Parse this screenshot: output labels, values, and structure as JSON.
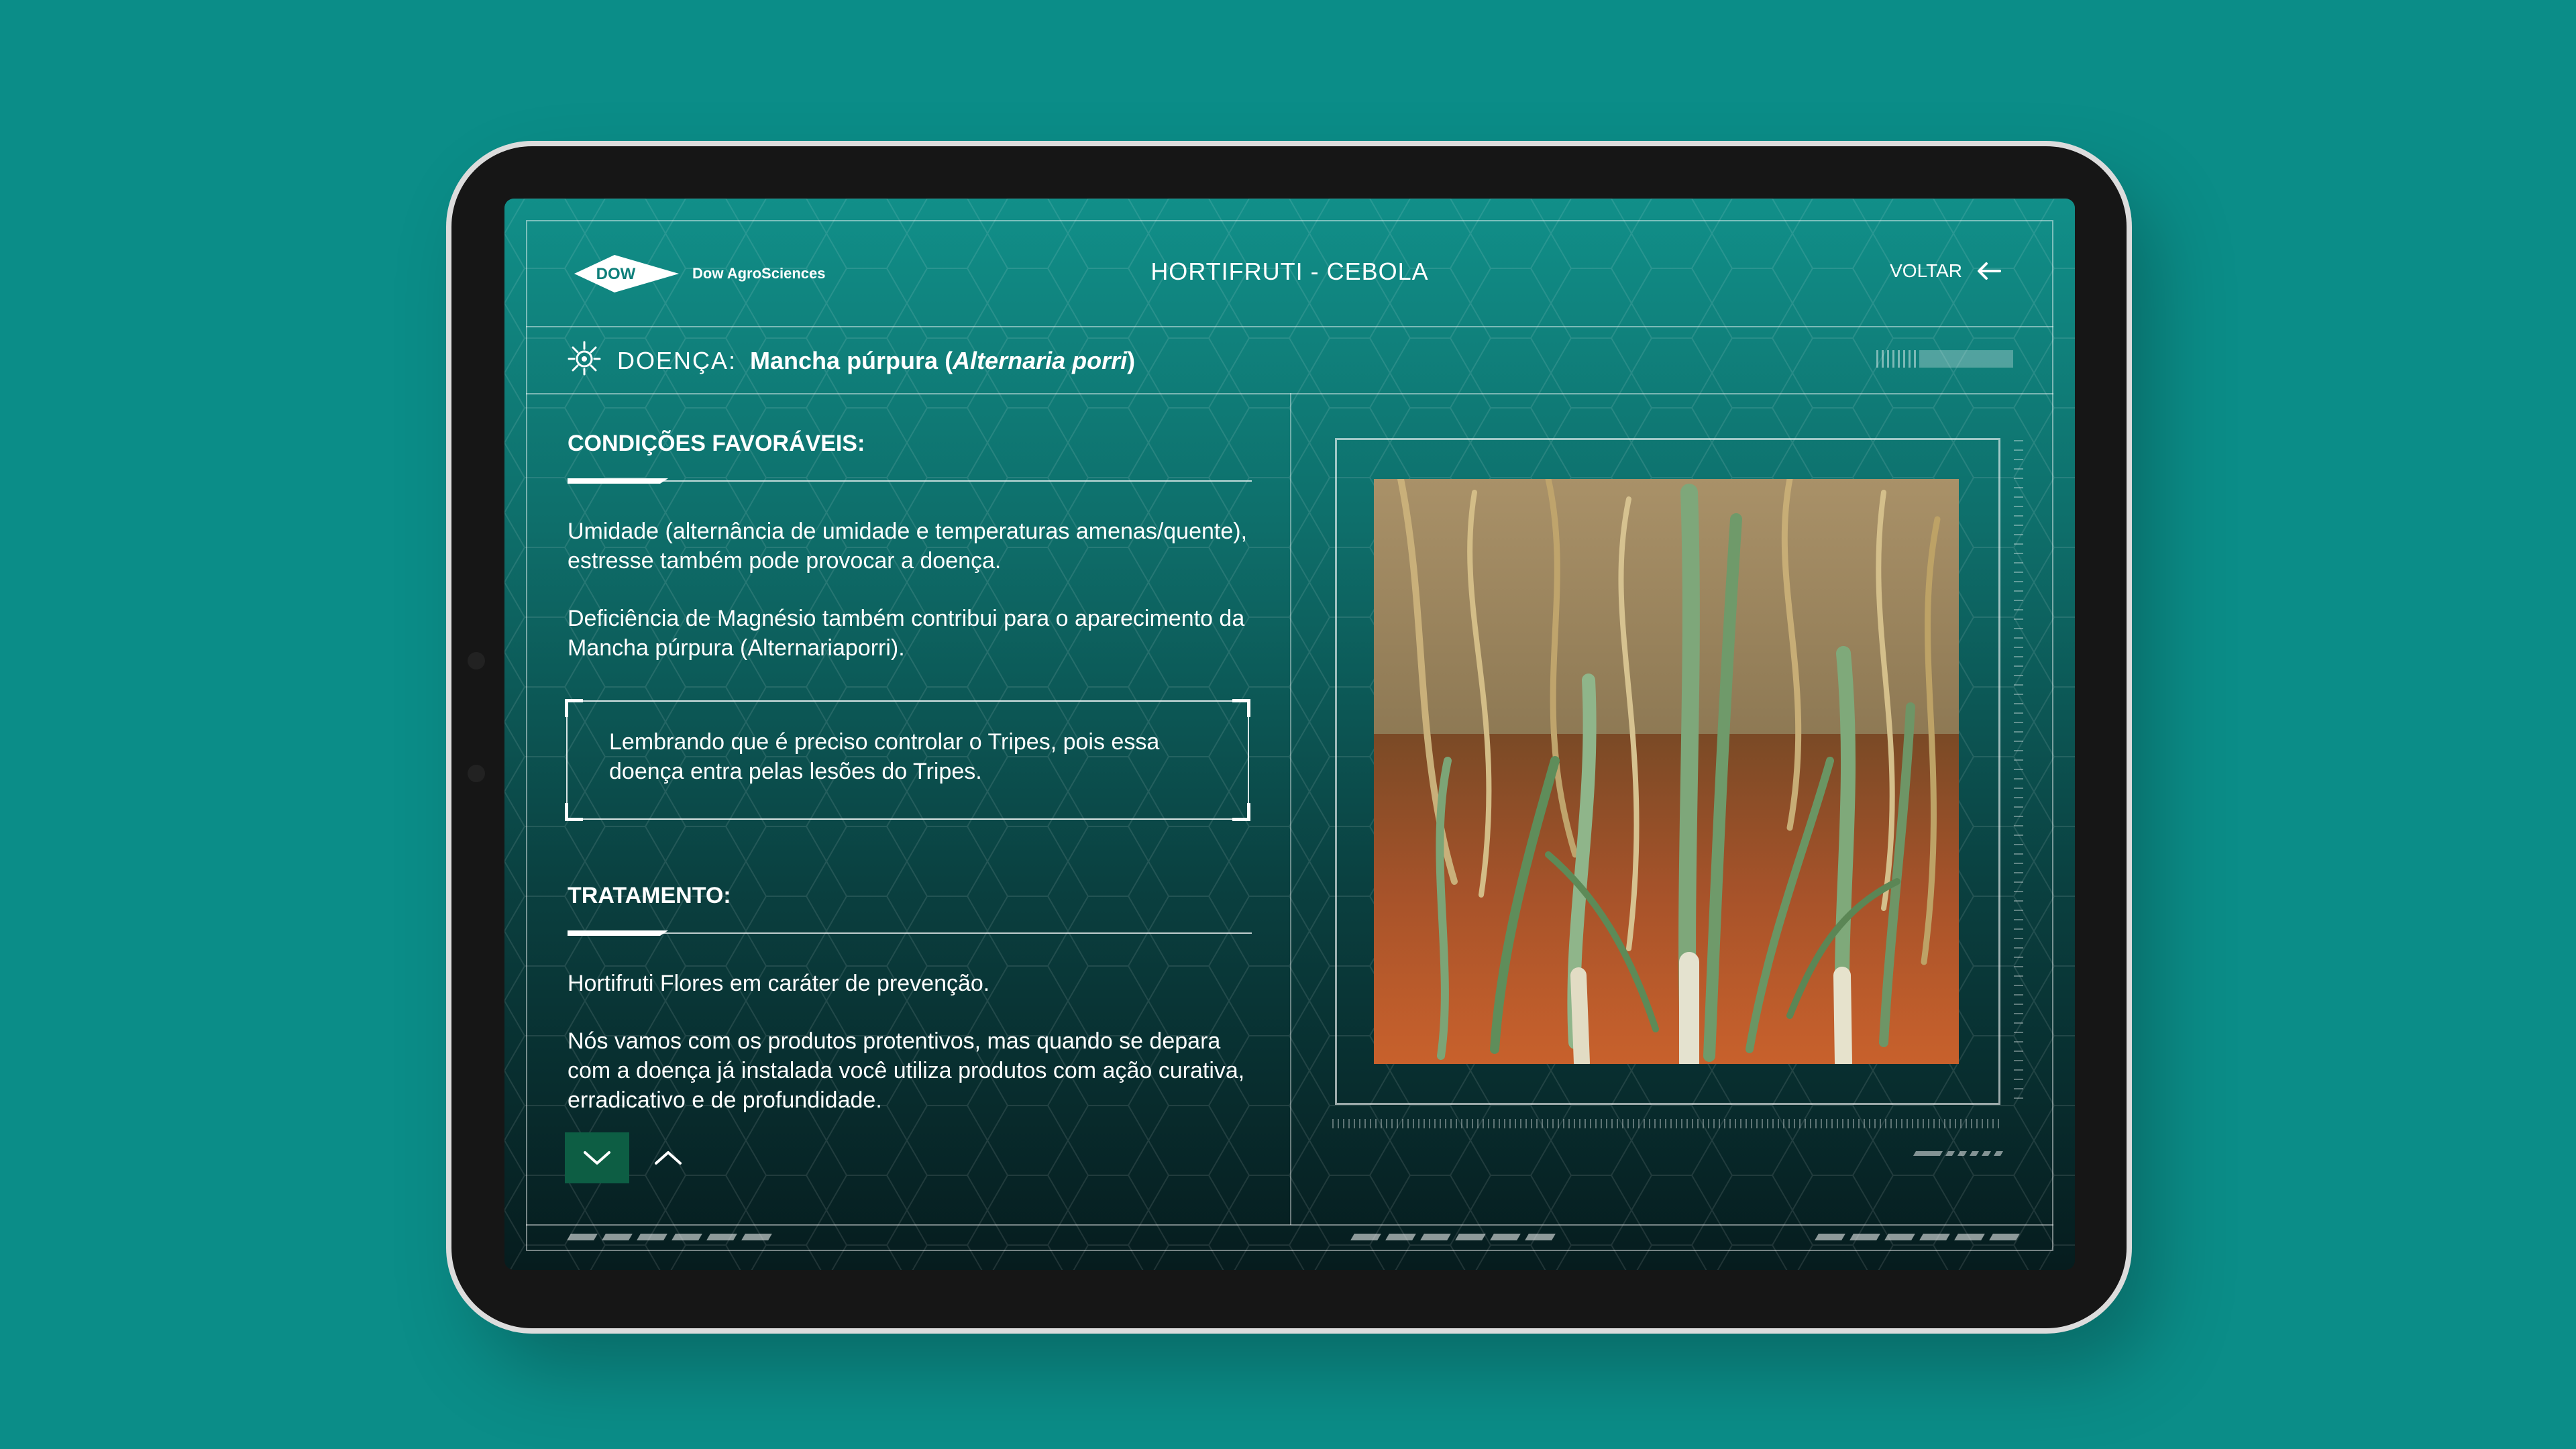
{
  "app": {
    "brand": "Dow AgroSciences",
    "logo_word": "DOW",
    "title": "HORTIFRUTI - CEBOLA",
    "back_label": "VOLTAR"
  },
  "disease": {
    "label": "DOENÇA:",
    "name": "Mancha púrpura (",
    "scientific": "Alternaria porri",
    "close": ")",
    "icon": "bug-icon"
  },
  "conditions": {
    "title": "CONDIÇÕES FAVORÁVEIS:",
    "paragraphs": [
      "Umidade (alternância de umidade e temperaturas amenas/quente), estresse também pode provocar a doença.",
      "Deficiência de Magnésio também contribui para o aparecimento da Mancha púrpura (Alternariaporri)."
    ],
    "note": "Lembrando que é preciso controlar o Tripes, pois essa doença entra pelas lesões do Tripes."
  },
  "treatment": {
    "title": "TRATAMENTO:",
    "paragraphs": [
      "Hortifruti Flores em caráter de prevenção.",
      "Nós vamos com os produtos protentivos, mas quando se depara com a doença já instalada você utiliza produtos com ação curativa, erradicativo e de profundidade."
    ]
  },
  "controls": {
    "down_icon": "chevron-down-icon",
    "up_icon": "chevron-up-icon"
  },
  "colors": {
    "background": "#0b8d88",
    "accent_button": "#0d5e44",
    "text": "#ffffff"
  }
}
